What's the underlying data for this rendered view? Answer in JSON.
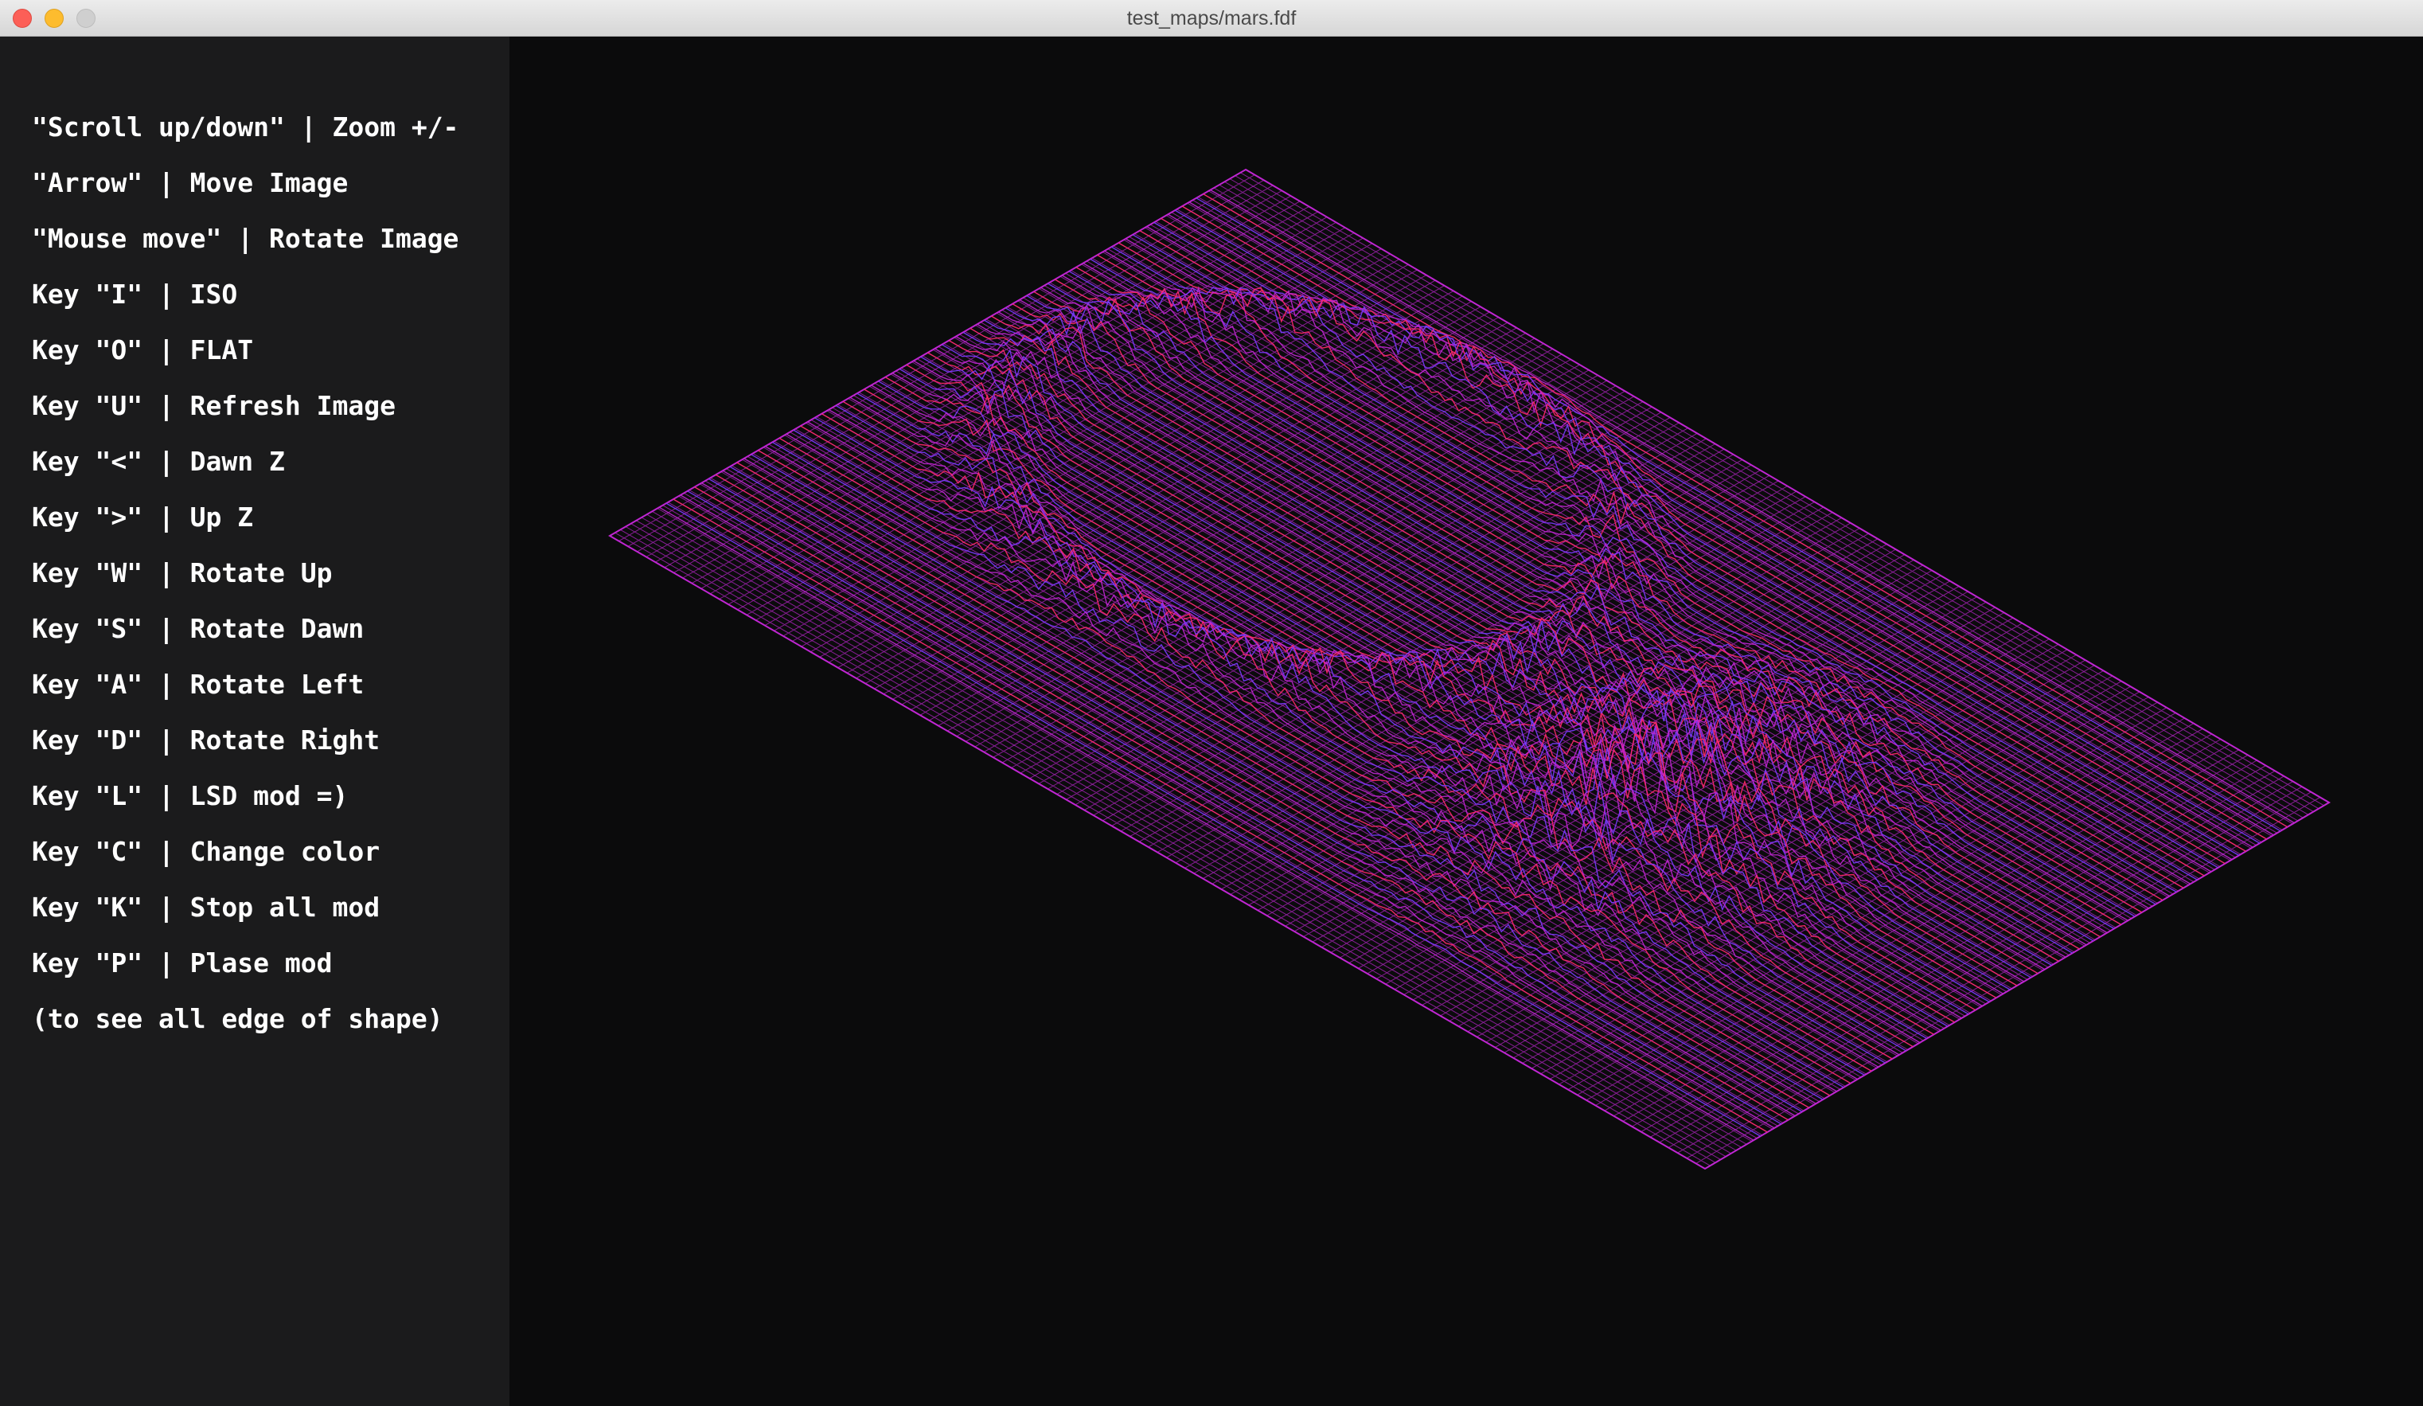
{
  "window": {
    "title": "test_maps/mars.fdf",
    "buttons": [
      "close",
      "minimize",
      "zoom"
    ]
  },
  "sidebar": {
    "lines": [
      "\"Scroll up/down\" | Zoom +/-",
      "\"Arrow\" | Move Image",
      "\"Mouse move\" | Rotate Image",
      "Key \"I\" | ISO",
      "Key \"O\" | FLAT",
      "Key \"U\" | Refresh Image",
      "Key \"<\" | Dawn Z",
      "Key \">\" | Up Z",
      "Key \"W\" | Rotate Up",
      "Key \"S\" | Rotate Dawn",
      "Key \"A\" | Rotate Left",
      "Key \"D\" | Rotate Right",
      "Key \"L\" | LSD mod =)",
      "Key \"C\" | Change color",
      "Key \"K\" | Stop all mod",
      "Key \"P\" | Plase mod",
      "(to see all edge of shape)"
    ]
  },
  "colors": {
    "text": "#ffffff",
    "sidebar_bg": "#1b1b1c",
    "canvas_bg": "#0b0b0c",
    "wire_base": "#c026d3",
    "wire_red": "#ff2a6a",
    "wire_blue": "#7a3cff"
  }
}
